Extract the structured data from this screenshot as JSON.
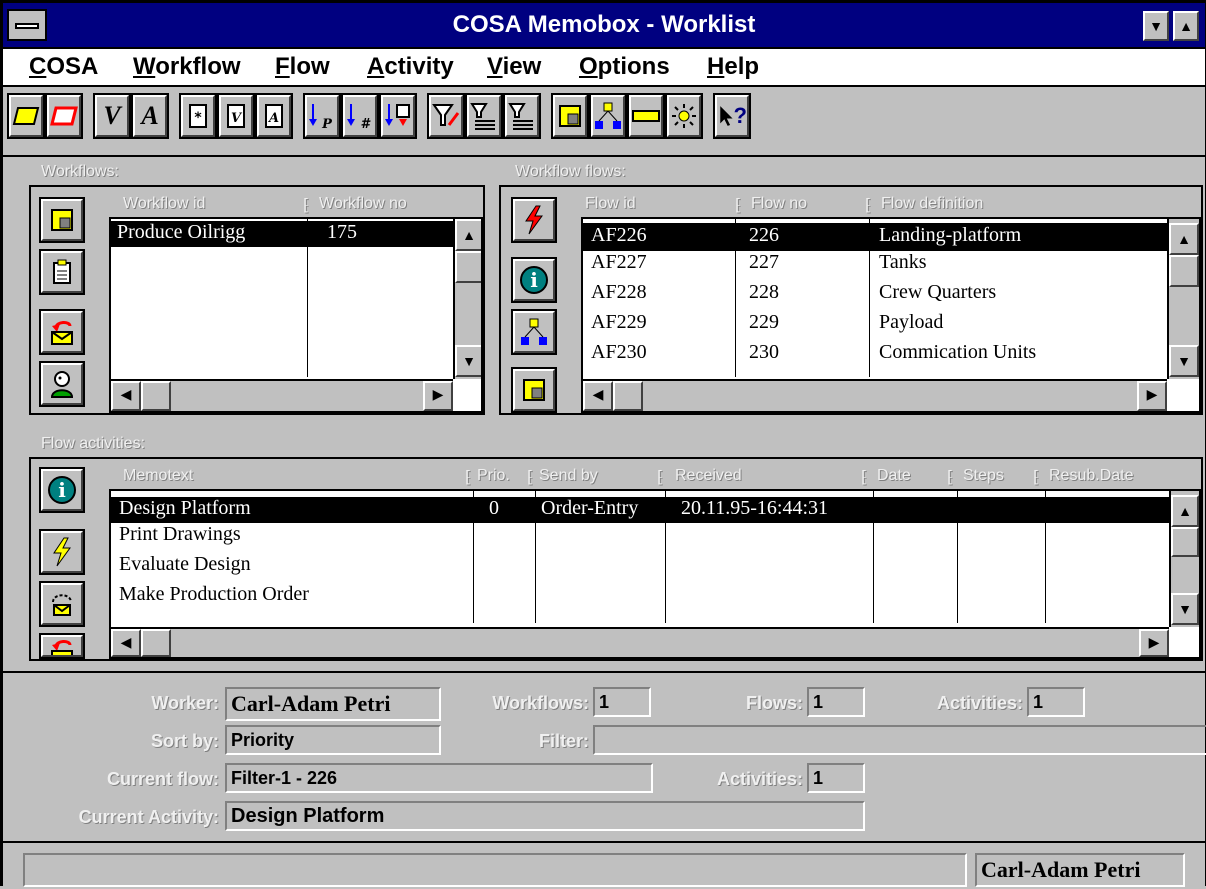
{
  "window": {
    "title": "COSA Memobox - Worklist"
  },
  "menu": [
    {
      "label": "COSA",
      "ul": "C",
      "rest": "OSA"
    },
    {
      "label": "Workflow",
      "ul": "W",
      "rest": "orkflow"
    },
    {
      "label": "Flow",
      "ul": "F",
      "rest": "low"
    },
    {
      "label": "Activity",
      "ul": "A",
      "rest": "ctivity"
    },
    {
      "label": "View",
      "ul": "V",
      "rest": "iew"
    },
    {
      "label": "Options",
      "ul": "O",
      "rest": "ptions"
    },
    {
      "label": "Help",
      "ul": "H",
      "rest": "elp"
    }
  ],
  "toolbar": {
    "v_label": "V",
    "a_label": "A",
    "help_label": "?"
  },
  "workflows": {
    "label": "Workflows:",
    "columns": [
      "Workflow id",
      "Workflow no"
    ],
    "rows": [
      {
        "id": "Produce Oilrigg",
        "no": "175"
      }
    ]
  },
  "workflow_flows": {
    "label": "Workflow flows:",
    "columns": [
      "Flow id",
      "Flow no",
      "Flow definition"
    ],
    "rows": [
      {
        "id": "AF226",
        "no": "226",
        "def": "Landing-platform"
      },
      {
        "id": "AF227",
        "no": "227",
        "def": "Tanks"
      },
      {
        "id": "AF228",
        "no": "228",
        "def": "Crew Quarters"
      },
      {
        "id": "AF229",
        "no": "229",
        "def": "Payload"
      },
      {
        "id": "AF230",
        "no": "230",
        "def": "Commication Units"
      }
    ]
  },
  "flow_activities": {
    "label": "Flow activities:",
    "columns": [
      "Memotext",
      "Prio.",
      "Send by",
      "Received",
      "Date",
      "Steps",
      "Resub.Date"
    ],
    "rows": [
      {
        "memo": "Design Platform",
        "prio": "0",
        "sendby": "Order-Entry",
        "received": "20.11.95-16:44:31"
      },
      {
        "memo": "Print Drawings",
        "prio": "",
        "sendby": "",
        "received": ""
      },
      {
        "memo": "Evaluate Design",
        "prio": "",
        "sendby": "",
        "received": ""
      },
      {
        "memo": "Make Production Order",
        "prio": "",
        "sendby": "",
        "received": ""
      }
    ]
  },
  "status": {
    "worker_label": "Worker:",
    "worker": "Carl-Adam Petri",
    "workflows_label": "Workflows:",
    "workflows": "1",
    "flows_label": "Flows:",
    "flows": "1",
    "activities_label": "Activities:",
    "activities": "1",
    "sortby_label": "Sort by:",
    "sortby": "Priority",
    "filter_label": "Filter:",
    "filter": "",
    "currentflow_label": "Current flow:",
    "currentflow": "Filter-1 - 226",
    "activities2_label": "Activities:",
    "activities2": "1",
    "currentactivity_label": "Current Activity:",
    "currentactivity": "Design Platform"
  },
  "statusbar": {
    "user": "Carl-Adam Petri"
  }
}
